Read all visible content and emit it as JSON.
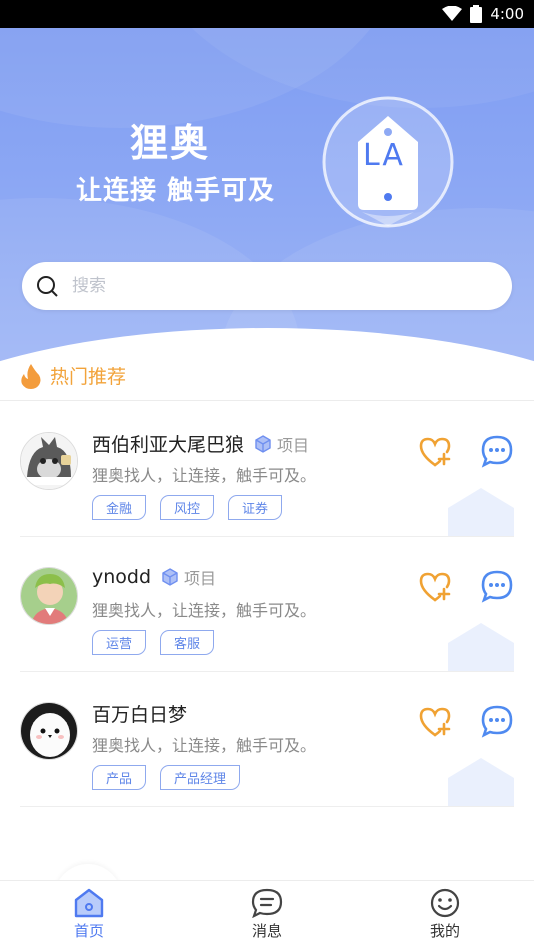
{
  "status_bar": {
    "time": "4:00"
  },
  "hero": {
    "title": "狸奥",
    "subtitle": "让连接 触手可及",
    "logo_text": "LA"
  },
  "search": {
    "placeholder": "搜索",
    "value": ""
  },
  "section": {
    "title": "热门推荐"
  },
  "cards": [
    {
      "name": "西伯利亚大尾巴狼",
      "type": "项目",
      "desc": "狸奥找人，让连接，触手可及。",
      "tags": [
        "金融",
        "风控",
        "证券"
      ]
    },
    {
      "name": "ynodd",
      "type": "项目",
      "desc": "狸奥找人，让连接，触手可及。",
      "tags": [
        "运营",
        "客服"
      ]
    },
    {
      "name": "百万白日梦",
      "type": "",
      "desc": "狸奥找人，让连接，触手可及。",
      "tags": [
        "产品",
        "产品经理"
      ]
    }
  ],
  "tabbar": {
    "items": [
      {
        "label": "首页",
        "active": true
      },
      {
        "label": "消息",
        "active": false
      },
      {
        "label": "我的",
        "active": false
      }
    ]
  },
  "colors": {
    "accent": "#4f7af0",
    "hero": "#8ea9f4",
    "orange": "#f2a33a"
  }
}
